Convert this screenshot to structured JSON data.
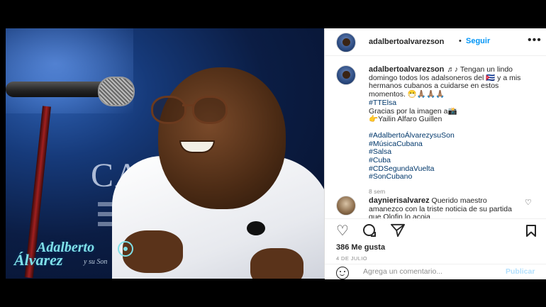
{
  "post": {
    "username": "adalbertoalvarezson",
    "follow_dot": "•",
    "follow_label": "Seguir",
    "more_label": "•••",
    "caption": {
      "line1": "♬♪ Tengan un lindo domingo todos los adalsoneros del 🇨🇺 y a mis hermanos cubanos a cuidarse en estos momentos. 😷🙏🏽🙏🏽🙏🏽",
      "tag1": "#TTElsa",
      "credit1": "Gracias por la imagen a📸",
      "credit2": "👉Yailin Alfaro Guillen",
      "hashtags": [
        "#AdalbertoÁlvarezysuSon",
        "#MúsicaCubana",
        "#Salsa",
        "#Cuba",
        "#CDSegundaVuelta",
        "#SonCubano"
      ],
      "time": "8 sem"
    },
    "comment": {
      "username": "daynierisalvarez",
      "text": "Querido maestro amanezco con la triste noticia de su partida que Olofin lo acoja"
    },
    "likes": "386 Me gusta",
    "date": "4 DE JULIO",
    "add_comment_placeholder": "Agrega un comentario...",
    "publish_label": "Publicar"
  },
  "photo": {
    "sign_text": "CASA",
    "logo_line1": "Adalberto",
    "logo_line2": "Álvarez",
    "logo_line3": "y su Son"
  },
  "icons": {
    "like": "heart-outline",
    "comment": "speech-bubble",
    "share": "paper-plane",
    "save": "bookmark",
    "emoji": "smiley-face",
    "more": "ellipsis"
  },
  "colors": {
    "link": "#00376b",
    "follow": "#0095f6",
    "publish_disabled": "#b2dffc",
    "text": "#262626",
    "muted": "#8e8e8e"
  }
}
